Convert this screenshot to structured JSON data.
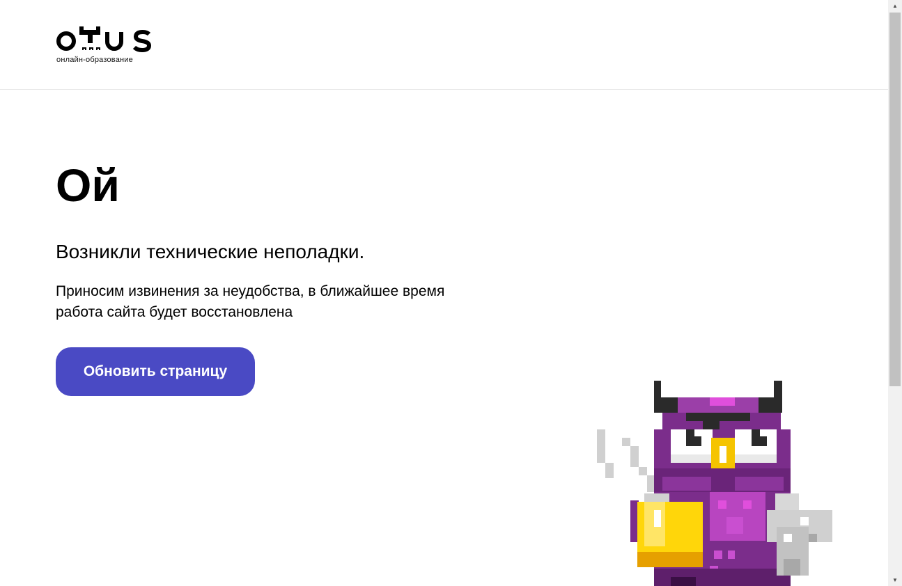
{
  "header": {
    "logo_tagline": "онлайн-образование"
  },
  "main": {
    "title": "Ой",
    "subtitle": "Возникли технические неполадки.",
    "description": "Приносим извинения за неудобства, в ближайшее время работа сайта будет восстановлена",
    "refresh_button": "Обновить страницу"
  },
  "brand": {
    "accent": "#4a4ac4",
    "owl_purple": "#7b2d8b",
    "owl_pink": "#d94fd8",
    "owl_yellow": "#ffd60a"
  },
  "icons": {
    "logo": "otus-logo",
    "mascot": "pixel-owl-with-coffee-icon",
    "scroll_up": "triangle-up-icon",
    "scroll_down": "triangle-down-icon"
  }
}
